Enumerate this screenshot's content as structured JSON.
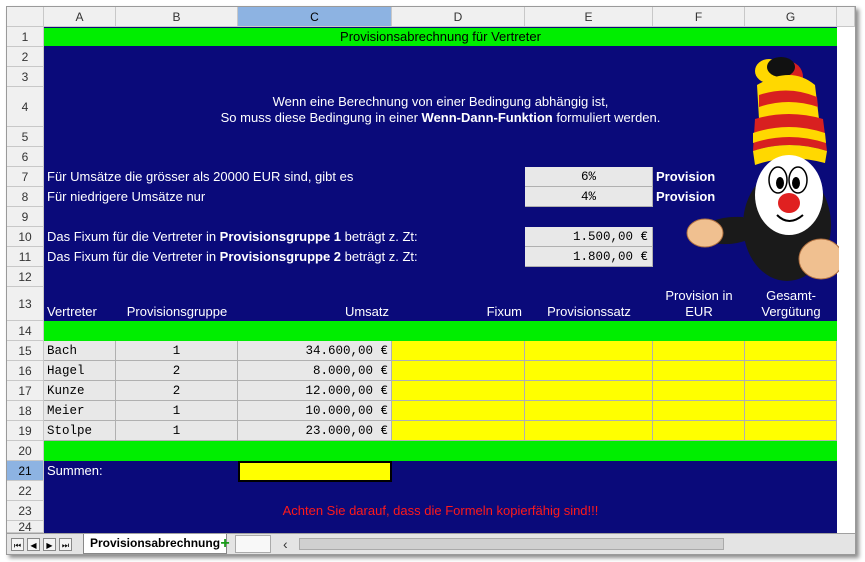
{
  "columns": [
    "A",
    "B",
    "C",
    "D",
    "E",
    "F",
    "G"
  ],
  "selected_column": "C",
  "rows": [
    "1",
    "2",
    "3",
    "4",
    "5",
    "6",
    "7",
    "8",
    "9",
    "10",
    "11",
    "12",
    "13",
    "14",
    "15",
    "16",
    "17",
    "18",
    "19",
    "20",
    "21",
    "22",
    "23",
    "24"
  ],
  "selected_row": "21",
  "title": "Provisionsabrechnung für Vertreter",
  "intro": {
    "line1": "Wenn eine Berechnung von einer Bedingung abhängig ist,",
    "line2_pre": "So muss diese Bedingung in einer ",
    "line2_bold": "Wenn-Dann-Funktion",
    "line2_post": " formuliert werden."
  },
  "conditions": {
    "row7_text": "Für Umsätze die grösser als 20000 EUR sind, gibt es",
    "row7_value": "6%",
    "row7_label": "Provision",
    "row8_text": "Für niedrigere Umsätze nur",
    "row8_value": "4%",
    "row8_label": "Provision"
  },
  "fixum": {
    "row10_pre": "Das Fixum für die Vertreter in ",
    "row10_bold": "Provisionsgruppe 1",
    "row10_post": " beträgt z. Zt:",
    "row10_value": "1.500,00 €",
    "row11_pre": "Das Fixum für die Vertreter in ",
    "row11_bold": "Provisionsgruppe 2",
    "row11_post": "  beträgt z. Zt:",
    "row11_value": "1.800,00 €"
  },
  "table": {
    "headers": {
      "vertreter": "Vertreter",
      "gruppe": "Provisionsgruppe",
      "umsatz": "Umsatz",
      "fixum": "Fixum",
      "satz": "Provisionssatz",
      "prov_eur_1": "Provision in",
      "prov_eur_2": "EUR",
      "gesamt_1": "Gesamt-",
      "gesamt_2": "Vergütung"
    },
    "rows": [
      {
        "name": "Bach",
        "gruppe": "1",
        "umsatz": "34.600,00 €"
      },
      {
        "name": "Hagel",
        "gruppe": "2",
        "umsatz": "8.000,00 €"
      },
      {
        "name": "Kunze",
        "gruppe": "2",
        "umsatz": "12.000,00 €"
      },
      {
        "name": "Meier",
        "gruppe": "1",
        "umsatz": "10.000,00 €"
      },
      {
        "name": "Stolpe",
        "gruppe": "1",
        "umsatz": "23.000,00 €"
      }
    ]
  },
  "summen_label": "Summen:",
  "warning": "Achten Sie darauf, dass die Formeln kopierfähig sind!!!",
  "sheet_tab": "Provisionsabrechnung",
  "add_tab_symbol": "+",
  "nav_buttons": [
    "⏮",
    "◀",
    "▶",
    "⏭"
  ],
  "scroll_left_symbol": "‹",
  "colors": {
    "navy": "#0a0a7a",
    "green": "#00ee00",
    "yellow": "#ffff00",
    "warning_red": "#ff1a1a"
  },
  "mascot_icon": "mole-with-striped-hat-icon"
}
